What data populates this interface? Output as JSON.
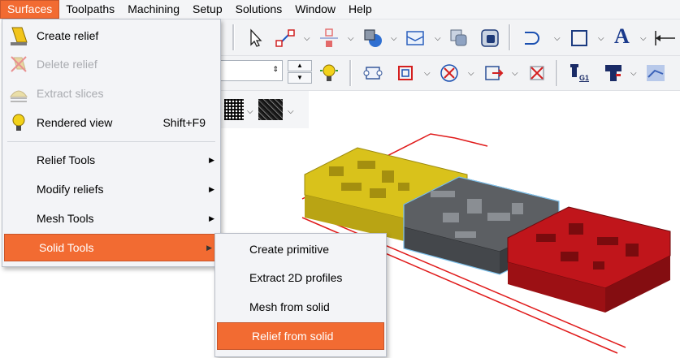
{
  "menubar": {
    "items": [
      "Surfaces",
      "Toolpaths",
      "Machining",
      "Setup",
      "Solutions",
      "Window",
      "Help"
    ],
    "active_index": 0
  },
  "surfaces_menu": {
    "items": [
      {
        "label": "Create relief",
        "shortcut": "",
        "enabled": true,
        "icon": "create-relief-icon"
      },
      {
        "label": "Delete relief",
        "shortcut": "",
        "enabled": false,
        "icon": "delete-relief-icon"
      },
      {
        "label": "Extract slices",
        "shortcut": "",
        "enabled": false,
        "icon": "extract-slices-icon"
      },
      {
        "label": "Rendered view",
        "shortcut": "Shift+F9",
        "enabled": true,
        "icon": "lightbulb-icon"
      },
      {
        "label": "Relief Tools",
        "submenu": true
      },
      {
        "label": "Modify reliefs",
        "submenu": true
      },
      {
        "label": "Mesh Tools",
        "submenu": true
      },
      {
        "label": "Solid Tools",
        "submenu": true,
        "highlighted": true
      }
    ]
  },
  "solid_tools_submenu": {
    "items": [
      {
        "label": "Create primitive"
      },
      {
        "label": "Extract 2D profiles"
      },
      {
        "label": "Mesh from solid"
      },
      {
        "label": "Relief from solid",
        "highlighted": true
      }
    ]
  },
  "toolbar": {
    "gcode_badge": "G1",
    "text_tool_glyph": "A"
  },
  "colors": {
    "accent": "#f26b32",
    "part_yellow": "#d9c21b",
    "part_gray": "#5c5f63",
    "part_red": "#c0151b",
    "boundary_red": "#e01a1a",
    "selection_blue": "#7fc3ee"
  }
}
